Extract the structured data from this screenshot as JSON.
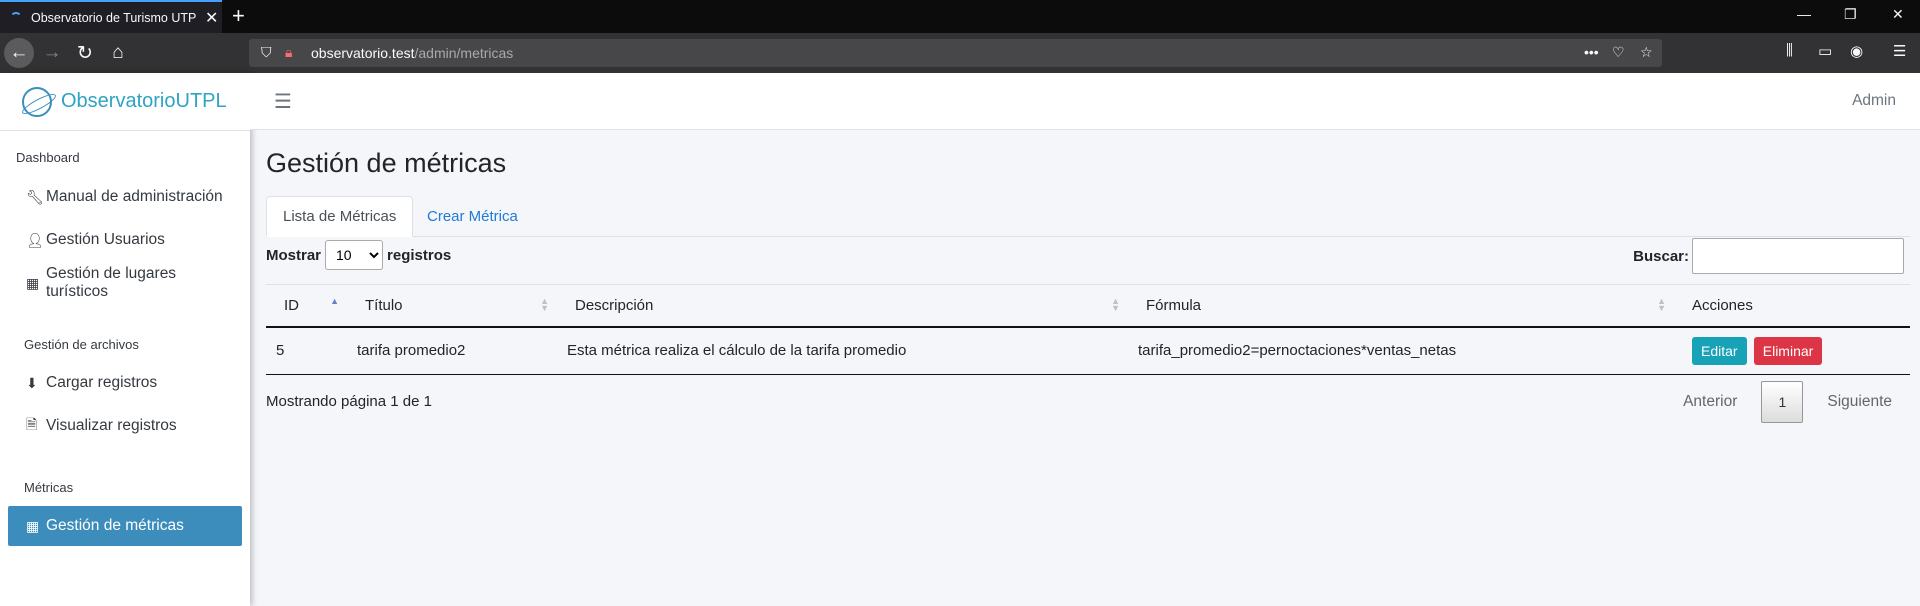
{
  "browser": {
    "tab_title": "Observatorio de Turismo UTPL",
    "url_host": "observatorio.test",
    "url_path": "/admin/metricas"
  },
  "brand": {
    "name_main": "Observatorio",
    "name_suffix": "UTPL"
  },
  "header": {
    "user": "Admin"
  },
  "sidebar": {
    "sections": [
      {
        "label": "Dashboard"
      },
      {
        "label": "Gestión de archivos"
      },
      {
        "label": "Métricas"
      }
    ],
    "items": [
      {
        "label": "Manual de administración",
        "icon": "wrench-icon"
      },
      {
        "label": "Gestión Usuarios",
        "icon": "user-icon"
      },
      {
        "label": "Gestión de lugares turísticos",
        "icon": "building-icon"
      },
      {
        "label": "Cargar registros",
        "icon": "file-download-icon"
      },
      {
        "label": "Visualizar registros",
        "icon": "file-text-icon"
      },
      {
        "label": "Gestión de métricas",
        "icon": "calculator-icon",
        "active": true
      }
    ]
  },
  "page": {
    "title": "Gestión de métricas",
    "tabs": [
      {
        "label": "Lista de Métricas",
        "active": true
      },
      {
        "label": "Crear Métrica"
      }
    ],
    "length": {
      "prefix": "Mostrar",
      "value": "10",
      "suffix": "registros"
    },
    "search": {
      "label": "Buscar:"
    },
    "table": {
      "columns": [
        "ID",
        "Título",
        "Descripción",
        "Fórmula",
        "Acciones"
      ],
      "rows": [
        {
          "id": "5",
          "titulo": "tarifa promedio2",
          "descripcion": "Esta métrica realiza el cálculo de la tarifa promedio",
          "formula": "tarifa_promedio2=pernoctaciones*ventas_netas",
          "edit": "Editar",
          "delete": "Eliminar"
        }
      ]
    },
    "info": "Mostrando página 1 de 1",
    "pagination": {
      "prev": "Anterior",
      "current": "1",
      "next": "Siguiente"
    }
  },
  "colors": {
    "accent": "#3c8dbc",
    "link": "#1e7bd8",
    "edit": "#17a2b8",
    "delete": "#dc3545"
  }
}
